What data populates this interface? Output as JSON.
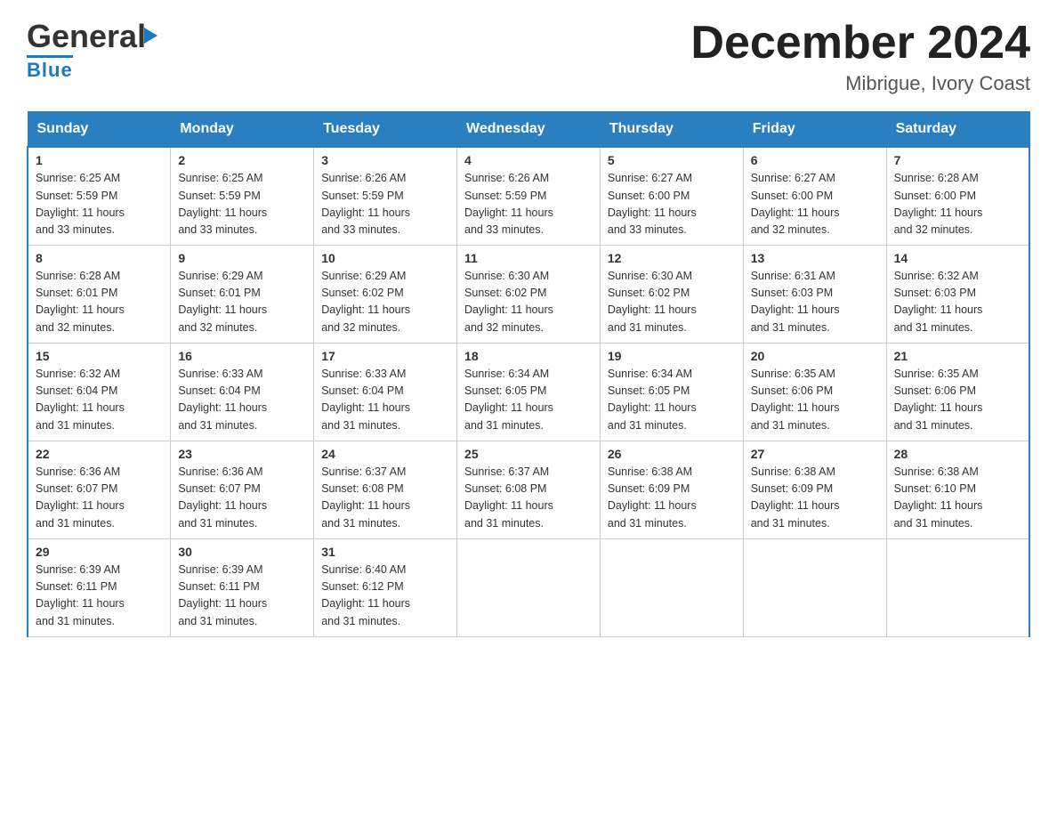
{
  "header": {
    "logo_text_general": "General",
    "logo_text_blue": "Blue",
    "month_title": "December 2024",
    "location": "Mibrigue, Ivory Coast"
  },
  "days_of_week": [
    "Sunday",
    "Monday",
    "Tuesday",
    "Wednesday",
    "Thursday",
    "Friday",
    "Saturday"
  ],
  "weeks": [
    [
      {
        "day": "1",
        "sunrise": "6:25 AM",
        "sunset": "5:59 PM",
        "daylight": "11 hours and 33 minutes."
      },
      {
        "day": "2",
        "sunrise": "6:25 AM",
        "sunset": "5:59 PM",
        "daylight": "11 hours and 33 minutes."
      },
      {
        "day": "3",
        "sunrise": "6:26 AM",
        "sunset": "5:59 PM",
        "daylight": "11 hours and 33 minutes."
      },
      {
        "day": "4",
        "sunrise": "6:26 AM",
        "sunset": "5:59 PM",
        "daylight": "11 hours and 33 minutes."
      },
      {
        "day": "5",
        "sunrise": "6:27 AM",
        "sunset": "6:00 PM",
        "daylight": "11 hours and 33 minutes."
      },
      {
        "day": "6",
        "sunrise": "6:27 AM",
        "sunset": "6:00 PM",
        "daylight": "11 hours and 32 minutes."
      },
      {
        "day": "7",
        "sunrise": "6:28 AM",
        "sunset": "6:00 PM",
        "daylight": "11 hours and 32 minutes."
      }
    ],
    [
      {
        "day": "8",
        "sunrise": "6:28 AM",
        "sunset": "6:01 PM",
        "daylight": "11 hours and 32 minutes."
      },
      {
        "day": "9",
        "sunrise": "6:29 AM",
        "sunset": "6:01 PM",
        "daylight": "11 hours and 32 minutes."
      },
      {
        "day": "10",
        "sunrise": "6:29 AM",
        "sunset": "6:02 PM",
        "daylight": "11 hours and 32 minutes."
      },
      {
        "day": "11",
        "sunrise": "6:30 AM",
        "sunset": "6:02 PM",
        "daylight": "11 hours and 32 minutes."
      },
      {
        "day": "12",
        "sunrise": "6:30 AM",
        "sunset": "6:02 PM",
        "daylight": "11 hours and 31 minutes."
      },
      {
        "day": "13",
        "sunrise": "6:31 AM",
        "sunset": "6:03 PM",
        "daylight": "11 hours and 31 minutes."
      },
      {
        "day": "14",
        "sunrise": "6:32 AM",
        "sunset": "6:03 PM",
        "daylight": "11 hours and 31 minutes."
      }
    ],
    [
      {
        "day": "15",
        "sunrise": "6:32 AM",
        "sunset": "6:04 PM",
        "daylight": "11 hours and 31 minutes."
      },
      {
        "day": "16",
        "sunrise": "6:33 AM",
        "sunset": "6:04 PM",
        "daylight": "11 hours and 31 minutes."
      },
      {
        "day": "17",
        "sunrise": "6:33 AM",
        "sunset": "6:04 PM",
        "daylight": "11 hours and 31 minutes."
      },
      {
        "day": "18",
        "sunrise": "6:34 AM",
        "sunset": "6:05 PM",
        "daylight": "11 hours and 31 minutes."
      },
      {
        "day": "19",
        "sunrise": "6:34 AM",
        "sunset": "6:05 PM",
        "daylight": "11 hours and 31 minutes."
      },
      {
        "day": "20",
        "sunrise": "6:35 AM",
        "sunset": "6:06 PM",
        "daylight": "11 hours and 31 minutes."
      },
      {
        "day": "21",
        "sunrise": "6:35 AM",
        "sunset": "6:06 PM",
        "daylight": "11 hours and 31 minutes."
      }
    ],
    [
      {
        "day": "22",
        "sunrise": "6:36 AM",
        "sunset": "6:07 PM",
        "daylight": "11 hours and 31 minutes."
      },
      {
        "day": "23",
        "sunrise": "6:36 AM",
        "sunset": "6:07 PM",
        "daylight": "11 hours and 31 minutes."
      },
      {
        "day": "24",
        "sunrise": "6:37 AM",
        "sunset": "6:08 PM",
        "daylight": "11 hours and 31 minutes."
      },
      {
        "day": "25",
        "sunrise": "6:37 AM",
        "sunset": "6:08 PM",
        "daylight": "11 hours and 31 minutes."
      },
      {
        "day": "26",
        "sunrise": "6:38 AM",
        "sunset": "6:09 PM",
        "daylight": "11 hours and 31 minutes."
      },
      {
        "day": "27",
        "sunrise": "6:38 AM",
        "sunset": "6:09 PM",
        "daylight": "11 hours and 31 minutes."
      },
      {
        "day": "28",
        "sunrise": "6:38 AM",
        "sunset": "6:10 PM",
        "daylight": "11 hours and 31 minutes."
      }
    ],
    [
      {
        "day": "29",
        "sunrise": "6:39 AM",
        "sunset": "6:11 PM",
        "daylight": "11 hours and 31 minutes."
      },
      {
        "day": "30",
        "sunrise": "6:39 AM",
        "sunset": "6:11 PM",
        "daylight": "11 hours and 31 minutes."
      },
      {
        "day": "31",
        "sunrise": "6:40 AM",
        "sunset": "6:12 PM",
        "daylight": "11 hours and 31 minutes."
      },
      null,
      null,
      null,
      null
    ]
  ],
  "labels": {
    "sunrise": "Sunrise:",
    "sunset": "Sunset:",
    "daylight": "Daylight:"
  },
  "colors": {
    "header_bg": "#2a7fc1",
    "header_text": "#ffffff",
    "border": "#2a7fc1",
    "cell_border": "#cccccc"
  }
}
